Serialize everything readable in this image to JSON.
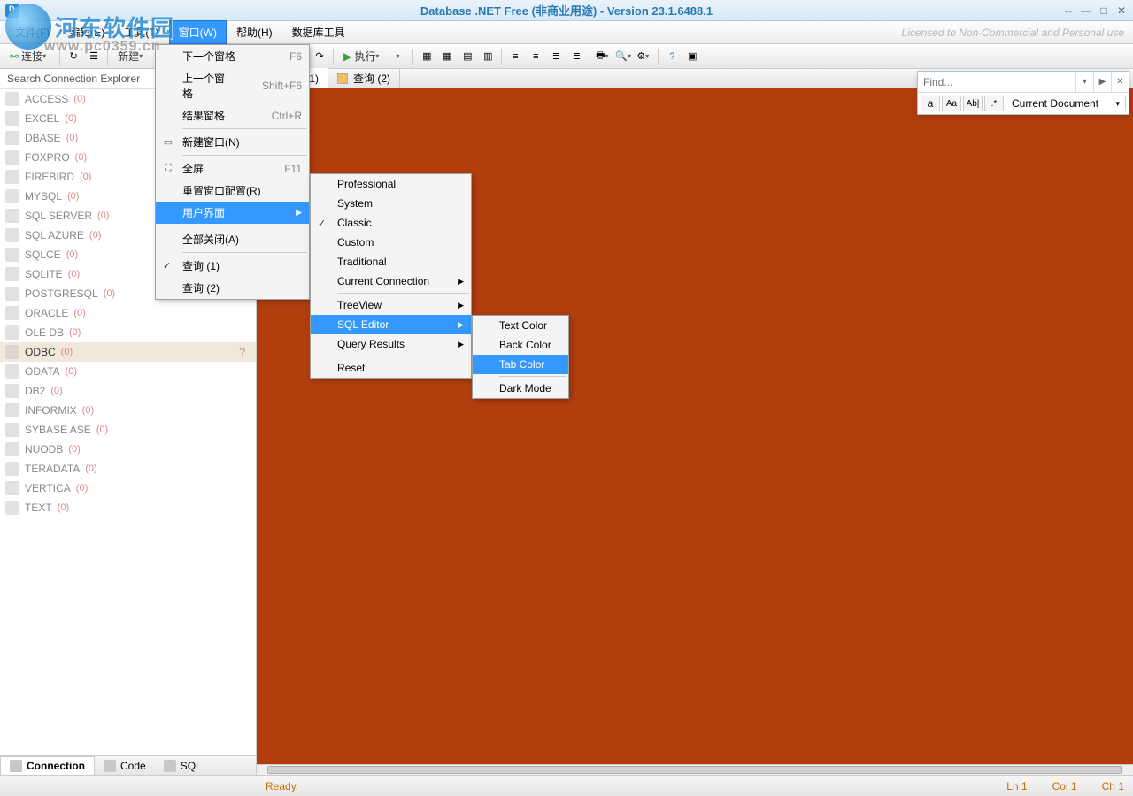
{
  "title": "Database .NET Free (非商业用途)  -  Version 23.1.6488.1",
  "license": "Licensed to Non-Commercial and Personal use",
  "watermark": {
    "name": "河东软件园",
    "url": "www.pc0359.cn"
  },
  "menubar": [
    "文件(F)",
    "编辑(E)",
    "工具(T)",
    "窗口(W)",
    "帮助(H)",
    "数据库工具"
  ],
  "menubar_active_index": 3,
  "toolbar": {
    "connect": "连接",
    "new": "新建",
    "execute": "执行"
  },
  "sidebar": {
    "search_placeholder": "Search Connection Explorer",
    "items": [
      {
        "name": "ACCESS",
        "count": "(0)"
      },
      {
        "name": "EXCEL",
        "count": "(0)"
      },
      {
        "name": "DBASE",
        "count": "(0)"
      },
      {
        "name": "FOXPRO",
        "count": "(0)"
      },
      {
        "name": "FIREBIRD",
        "count": "(0)"
      },
      {
        "name": "MYSQL",
        "count": "(0)"
      },
      {
        "name": "SQL SERVER",
        "count": "(0)"
      },
      {
        "name": "SQL AZURE",
        "count": "(0)"
      },
      {
        "name": "SQLCE",
        "count": "(0)"
      },
      {
        "name": "SQLITE",
        "count": "(0)"
      },
      {
        "name": "POSTGRESQL",
        "count": "(0)"
      },
      {
        "name": "ORACLE",
        "count": "(0)"
      },
      {
        "name": "OLE DB",
        "count": "(0)"
      },
      {
        "name": "ODBC",
        "count": "(0)",
        "selected": true,
        "q": "?"
      },
      {
        "name": "ODATA",
        "count": "(0)"
      },
      {
        "name": "DB2",
        "count": "(0)"
      },
      {
        "name": "INFORMIX",
        "count": "(0)"
      },
      {
        "name": "SYBASE ASE",
        "count": "(0)"
      },
      {
        "name": "NUODB",
        "count": "(0)"
      },
      {
        "name": "TERADATA",
        "count": "(0)"
      },
      {
        "name": "VERTICA",
        "count": "(0)"
      },
      {
        "name": "TEXT",
        "count": "(0)"
      }
    ]
  },
  "tabs": [
    {
      "label": "查询 (1)",
      "swatch": "#b23e0e"
    },
    {
      "label": "查询 (2)",
      "swatch": "#f0c060"
    }
  ],
  "editor_bg": "#b23e0e",
  "find": {
    "placeholder": "Find...",
    "scope": "Current Document",
    "opt_match": "a_ac",
    "opt_aa": "Aa",
    "opt_ab": "Ab|"
  },
  "window_menu": [
    {
      "label": "下一个窗格",
      "shortcut": "F6"
    },
    {
      "label": "上一个窗格",
      "shortcut": "Shift+F6"
    },
    {
      "label": "结果窗格",
      "shortcut": "Ctrl+R"
    },
    {
      "type": "sep"
    },
    {
      "label": "新建窗口(N)",
      "icon": "▭"
    },
    {
      "type": "sep"
    },
    {
      "label": "全屏",
      "shortcut": "F11",
      "icon": "⛶"
    },
    {
      "label": "重置窗口配置(R)"
    },
    {
      "label": "用户界面",
      "submenu": true,
      "selected": true
    },
    {
      "type": "sep"
    },
    {
      "label": "全部关闭(A)"
    },
    {
      "type": "sep"
    },
    {
      "label": "查询 (1)",
      "checked": true
    },
    {
      "label": "查询 (2)"
    }
  ],
  "ui_menu": [
    {
      "label": "Professional"
    },
    {
      "label": "System"
    },
    {
      "label": "Classic",
      "checked": true
    },
    {
      "label": "Custom"
    },
    {
      "label": "Traditional"
    },
    {
      "label": "Current Connection",
      "submenu": true
    },
    {
      "type": "sep"
    },
    {
      "label": "TreeView",
      "submenu": true
    },
    {
      "label": "SQL Editor",
      "submenu": true,
      "selected": true
    },
    {
      "label": "Query Results",
      "submenu": true
    },
    {
      "type": "sep"
    },
    {
      "label": "Reset"
    }
  ],
  "sql_editor_menu": [
    {
      "label": "Text Color"
    },
    {
      "label": "Back Color"
    },
    {
      "label": "Tab Color",
      "selected": true
    },
    {
      "type": "sep"
    },
    {
      "label": "Dark Mode"
    }
  ],
  "bottom_tabs": [
    {
      "label": "Connection",
      "active": true
    },
    {
      "label": "Code"
    },
    {
      "label": "SQL"
    }
  ],
  "status": {
    "ready": "Ready.",
    "ln": "Ln 1",
    "col": "Col 1",
    "ch": "Ch 1"
  }
}
